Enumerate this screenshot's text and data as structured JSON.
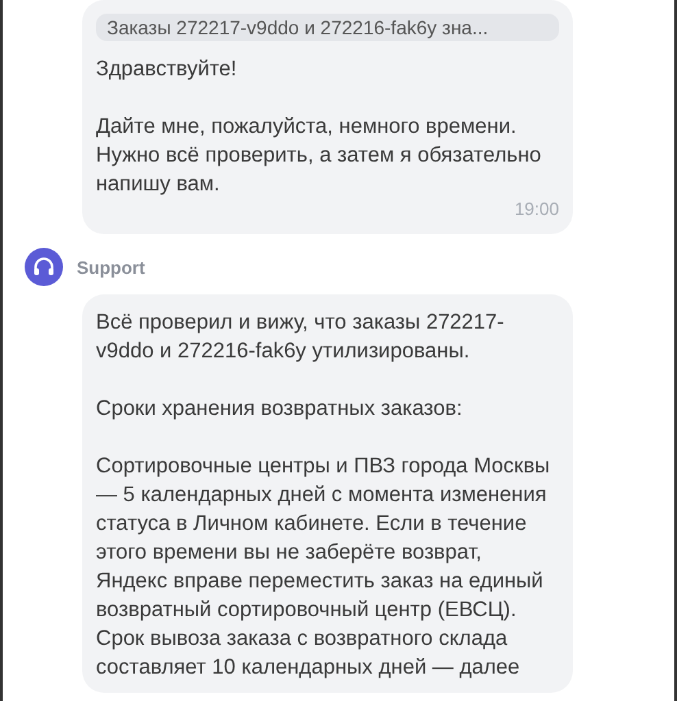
{
  "messages": [
    {
      "quote": "Заказы 272217-v9ddo и 272216-fak6y зна...",
      "paragraphs": [
        "Здравствуйте!",
        "Дайте мне, пожалуйста, немного времени. Нужно всё проверить, а затем я обязательно напишу вам."
      ],
      "time": "19:00"
    },
    {
      "sender": "Support",
      "paragraphs": [
        "Всё проверил и вижу, что заказы  272217-v9ddo и 272216-fak6y утилизированы.",
        "Сроки хранения возвратных заказов:",
        "Сортировочные центры и ПВЗ города Москвы — 5 календарных дней с момента изменения статуса в Личном кабинете. Если в течение этого времени вы не заберёте возврат, Яндекс вправе переместить заказ на единый возвратный сортировочный центр (ЕВСЦ). Срок вывоза заказа с возвратного склада составляет 10 календарных дней — далее"
      ]
    }
  ]
}
